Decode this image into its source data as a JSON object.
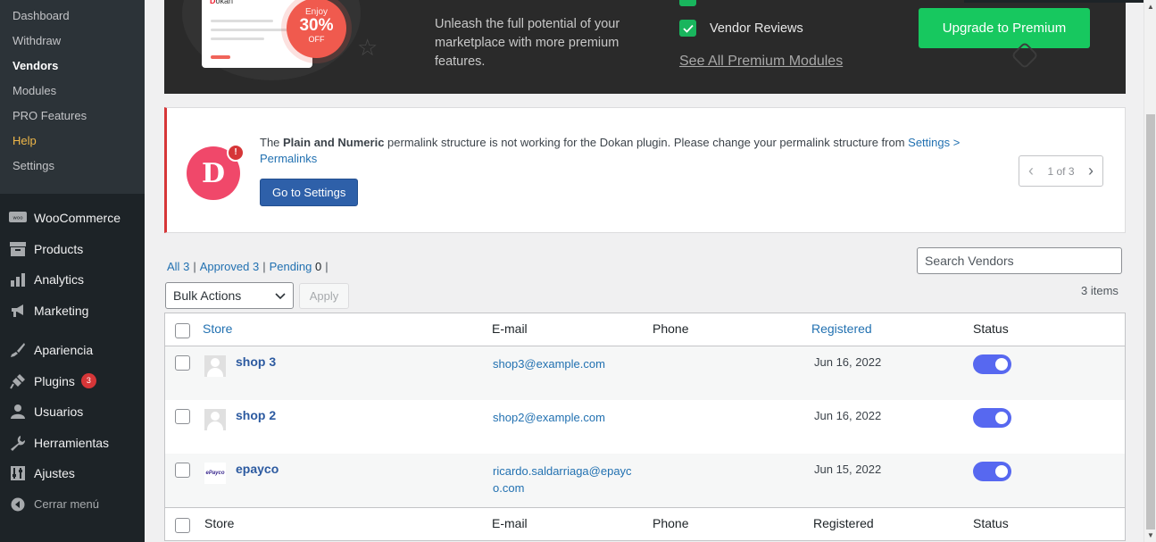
{
  "sidebar": {
    "submenu": [
      {
        "label": "Dashboard"
      },
      {
        "label": "Withdraw"
      },
      {
        "label": "Vendors"
      },
      {
        "label": "Modules"
      },
      {
        "label": "PRO Features"
      },
      {
        "label": "Help"
      },
      {
        "label": "Settings"
      }
    ],
    "menu": [
      {
        "label": "WooCommerce",
        "icon": "woo-icon"
      },
      {
        "label": "Products",
        "icon": "archive-icon"
      },
      {
        "label": "Analytics",
        "icon": "bar-chart-icon"
      },
      {
        "label": "Marketing",
        "icon": "megaphone-icon"
      },
      {
        "label": "Apariencia",
        "icon": "paintbrush-icon"
      },
      {
        "label": "Plugins",
        "icon": "plugin-icon",
        "badge": "3"
      },
      {
        "label": "Usuarios",
        "icon": "user-icon"
      },
      {
        "label": "Herramientas",
        "icon": "wrench-icon"
      },
      {
        "label": "Ajustes",
        "icon": "settings-icon"
      }
    ],
    "collapse_label": "Cerrar menú"
  },
  "banner": {
    "logo_text": "okan",
    "logo_letter": "D",
    "offer_top": "Enjoy",
    "offer_pct": "30%",
    "offer_bottom": "OFF",
    "description": "Unleash the full potential of your marketplace with more premium features.",
    "module_label": "Vendor Reviews",
    "see_all": "See All Premium Modules",
    "upgrade_label": "Upgrade to Premium"
  },
  "notice": {
    "logo_letter": "D",
    "text_pre": "The ",
    "text_bold": "Plain and Numeric",
    "text_post": " permalink structure is not working for the Dokan plugin. Please change your permalink structure from ",
    "link": "Settings > Permalinks",
    "button": "Go to Settings",
    "pager": "1 of 3"
  },
  "filters": {
    "all_label": "All",
    "all_count": "3",
    "approved_label": "Approved",
    "approved_count": "3",
    "pending_label": "Pending",
    "pending_count": "0",
    "bulk_label": "Bulk Actions",
    "apply_label": "Apply",
    "search_placeholder": "Search Vendors",
    "items_count": "3 items"
  },
  "table": {
    "headers": {
      "store": "Store",
      "email": "E-mail",
      "phone": "Phone",
      "registered": "Registered",
      "status": "Status"
    },
    "rows": [
      {
        "store": "shop 3",
        "email": "shop3@example.com",
        "phone": "",
        "registered": "Jun 16, 2022",
        "status": "enabled",
        "avatar": "default"
      },
      {
        "store": "shop 2",
        "email": "shop2@example.com",
        "phone": "",
        "registered": "Jun 16, 2022",
        "status": "enabled",
        "avatar": "default"
      },
      {
        "store": "epayco",
        "email": "ricardo.saldarriaga@epayco.com",
        "phone": "",
        "registered": "Jun 15, 2022",
        "status": "enabled",
        "avatar": "ePayco"
      }
    ]
  },
  "colors": {
    "sidebar_bg": "#1d2327",
    "accent_green": "#17c85f",
    "toggle_on": "#5768f0",
    "link_blue": "#2271b1",
    "notice_border": "#d63638"
  }
}
